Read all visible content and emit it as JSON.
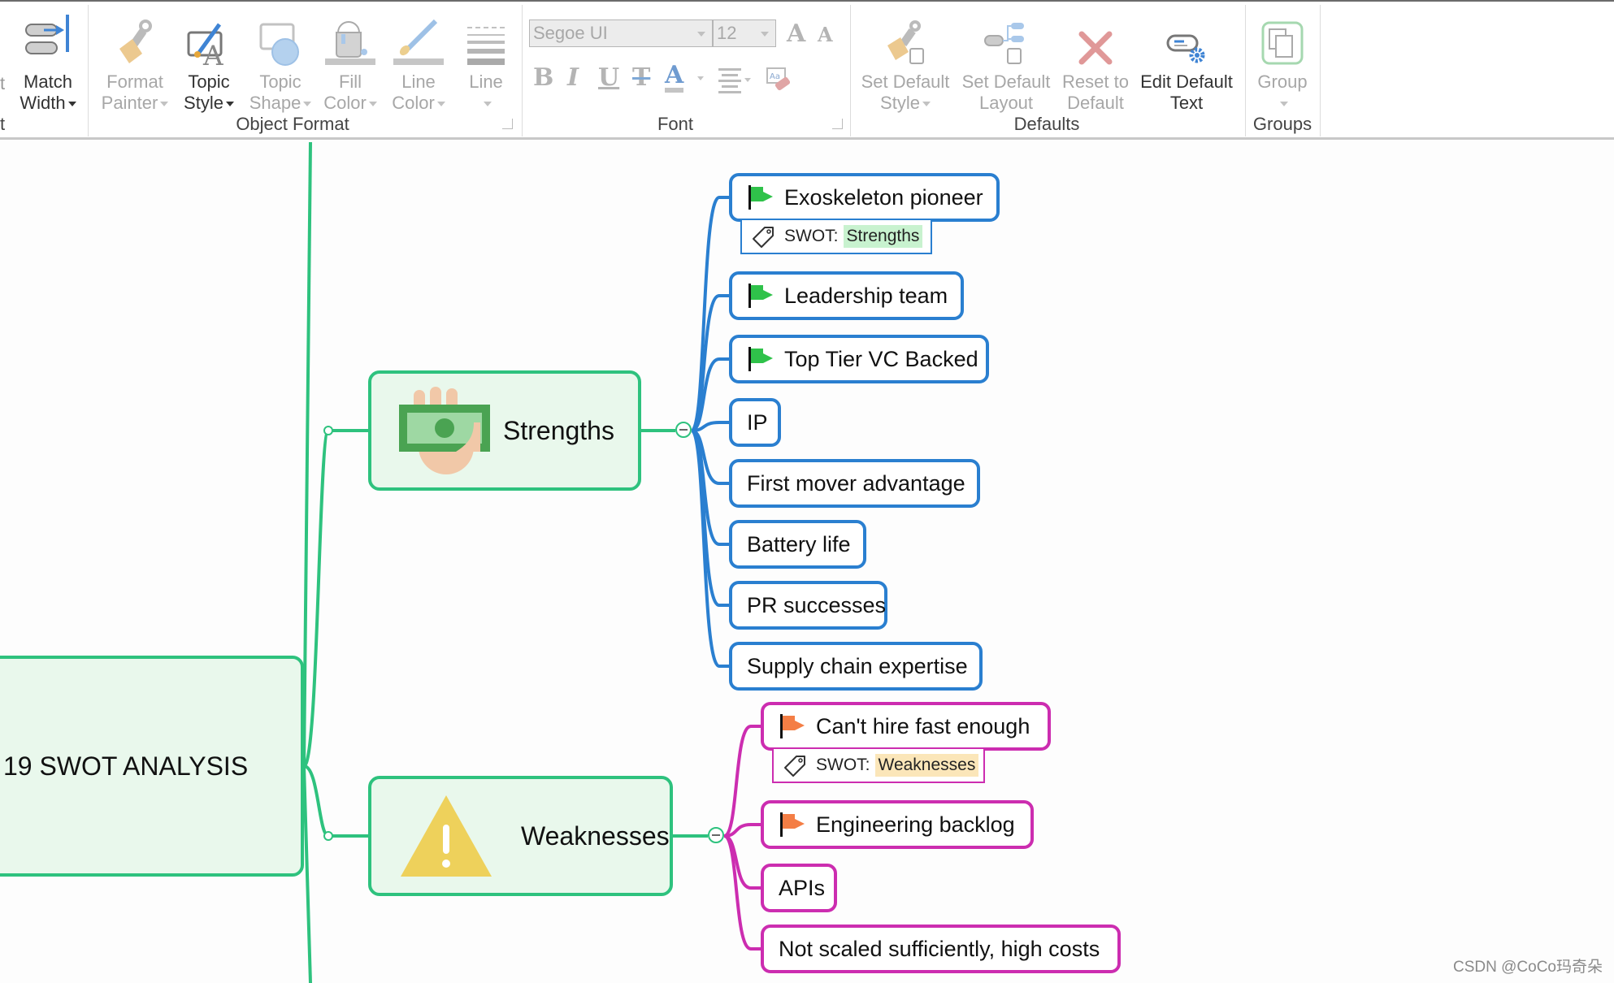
{
  "ribbon": {
    "partial_left_label": "t",
    "match_width": {
      "line1": "Match",
      "line2": "Width"
    },
    "object_format": {
      "label": "Object Format",
      "buttons": [
        {
          "line1": "Format",
          "line2": "Painter",
          "icon": "format-painter-icon",
          "enabled": false
        },
        {
          "line1": "Topic",
          "line2": "Style",
          "icon": "topic-style-icon",
          "enabled": true
        },
        {
          "line1": "Topic",
          "line2": "Shape",
          "icon": "topic-shape-icon",
          "enabled": false
        },
        {
          "line1": "Fill",
          "line2": "Color",
          "icon": "fill-color-icon",
          "enabled": false
        },
        {
          "line1": "Line",
          "line2": "Color",
          "icon": "line-color-icon",
          "enabled": false
        },
        {
          "line1": "Line",
          "line2": "",
          "icon": "line-style-icon",
          "enabled": false
        }
      ]
    },
    "font": {
      "label": "Font",
      "family": "Segoe UI",
      "size": "12",
      "grow": "A",
      "shrink": "A",
      "bold": "B",
      "italic": "I",
      "underline": "U",
      "strike": "T",
      "color": "A"
    },
    "defaults": {
      "label": "Defaults",
      "buttons": [
        {
          "line1": "Set Default",
          "line2": "Style",
          "enabled": false
        },
        {
          "line1": "Set Default",
          "line2": "Layout",
          "enabled": false
        },
        {
          "line1": "Reset to",
          "line2": "Default",
          "enabled": false
        },
        {
          "line1": "Edit Default",
          "line2": "Text",
          "enabled": true
        }
      ]
    },
    "groups": {
      "label": "Groups",
      "button": "Group"
    }
  },
  "map": {
    "root": {
      "title": "19 SWOT ANALYSIS"
    },
    "strengths": {
      "title": "Strengths",
      "icon": "money-hand-icon",
      "color": "#2a7fd0",
      "children": [
        {
          "text": "Exoskeleton pioneer",
          "flag": "green",
          "tag_prefix": "SWOT:",
          "tag_value": "Strengths"
        },
        {
          "text": "Leadership team",
          "flag": "green"
        },
        {
          "text": "Top Tier VC Backed",
          "flag": "green"
        },
        {
          "text": "IP"
        },
        {
          "text": "First mover advantage"
        },
        {
          "text": "Battery life"
        },
        {
          "text": "PR successes"
        },
        {
          "text": "Supply chain expertise"
        }
      ]
    },
    "weaknesses": {
      "title": "Weaknesses",
      "icon": "warning-icon",
      "color": "#cc2db0",
      "children": [
        {
          "text": "Can't hire fast enough",
          "flag": "orange",
          "tag_prefix": "SWOT:",
          "tag_value": "Weaknesses"
        },
        {
          "text": "Engineering backlog",
          "flag": "orange"
        },
        {
          "text": "APIs"
        },
        {
          "text": "Not scaled sufficiently, high costs"
        }
      ]
    },
    "colors": {
      "main_border": "#2ec27e",
      "main_fill": "#e9f8ec",
      "strength_line": "#2a7fd0",
      "weakness_line": "#cc2db0",
      "flag_green": "#2fc24a",
      "flag_orange": "#f47e45",
      "tag_strength_bg": "#c8f2cf",
      "tag_weakness_bg": "#fbe6b9"
    }
  },
  "watermark": "CSDN @CoCo玛奇朵"
}
